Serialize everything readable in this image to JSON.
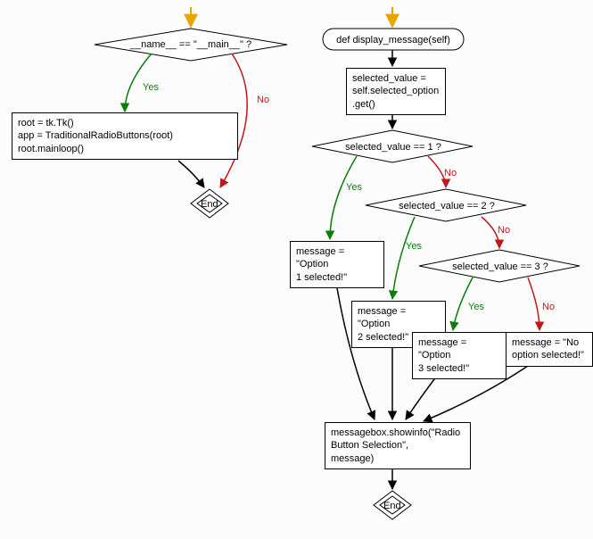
{
  "left": {
    "cond": "__name__ == \"__main__\" ?",
    "yes": "Yes",
    "no": "No",
    "body": "root = tk.Tk()\napp = TraditionalRadioButtons(root)\nroot.mainloop()",
    "end": "End"
  },
  "right": {
    "def": "def display_message(self)",
    "assign": "selected_value = \nself.selected_option\n.get()",
    "cond1": "selected_value == 1 ?",
    "cond2": "selected_value == 2 ?",
    "cond3": "selected_value == 3 ?",
    "yes": "Yes",
    "no": "No",
    "msg1": "message = \"Option\n1 selected!\"",
    "msg2": "message = \"Option\n2 selected!\"",
    "msg3": "message = \"Option\n3 selected!\"",
    "msg4": "message = \"No\noption selected!\"",
    "show": "messagebox.showinfo(\"Radio\nButton Selection\",\nmessage)",
    "end": "End"
  }
}
